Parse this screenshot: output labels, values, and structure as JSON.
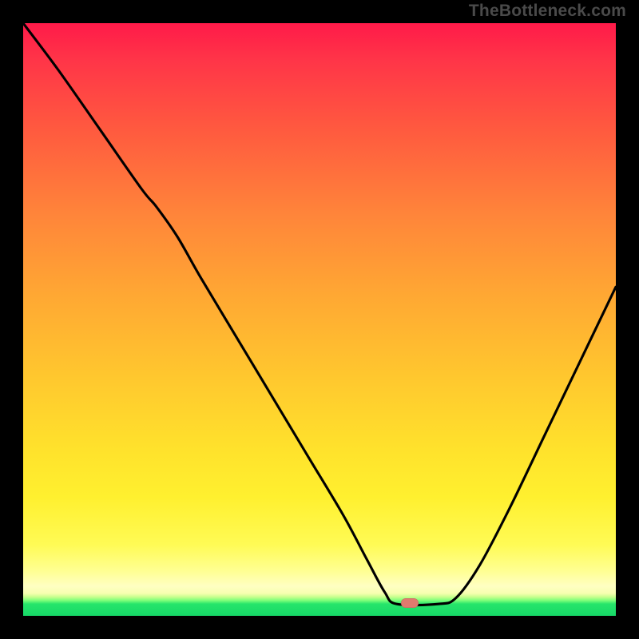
{
  "watermark": "TheBottleneck.com",
  "colors": {
    "curve": "#000000",
    "marker": "#e07a6e",
    "frame": "#000000"
  },
  "marker": {
    "x_frac": 0.652,
    "y_frac": 0.979
  },
  "chart_data": {
    "type": "line",
    "title": "",
    "xlabel": "",
    "ylabel": "",
    "xlim": [
      0,
      1
    ],
    "ylim": [
      0,
      1
    ],
    "note": "Axes are unlabeled in the source image; coordinates are normalized fractions of the plot area (0–1). y=0 at bottom, y=1 at top.",
    "series": [
      {
        "name": "curve",
        "x": [
          0.0,
          0.06,
          0.13,
          0.2,
          0.225,
          0.26,
          0.3,
          0.36,
          0.42,
          0.48,
          0.54,
          0.58,
          0.61,
          0.63,
          0.7,
          0.73,
          0.77,
          0.82,
          0.88,
          0.94,
          1.0
        ],
        "y": [
          1.0,
          0.92,
          0.82,
          0.72,
          0.69,
          0.64,
          0.57,
          0.47,
          0.37,
          0.27,
          0.17,
          0.095,
          0.04,
          0.02,
          0.02,
          0.03,
          0.085,
          0.18,
          0.305,
          0.43,
          0.555
        ]
      }
    ],
    "markers": [
      {
        "name": "highlight",
        "x": 0.652,
        "y": 0.021
      }
    ]
  }
}
